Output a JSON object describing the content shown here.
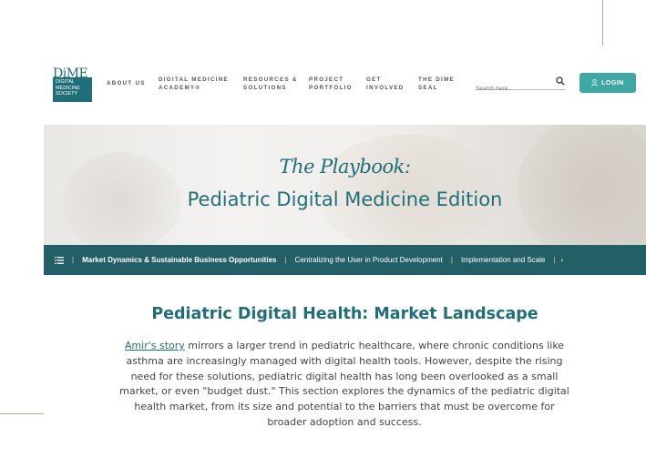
{
  "header": {
    "logo": {
      "wordmark": "DiME",
      "lines": [
        "DIGITAL",
        "MEDICINE",
        "SOCIETY"
      ]
    },
    "nav": [
      {
        "label_1": "ABOUT US",
        "label_2": ""
      },
      {
        "label_1": "DIGITAL MEDICINE",
        "label_2": "ACADEMY®"
      },
      {
        "label_1": "RESOURCES &",
        "label_2": "SOLUTIONS"
      },
      {
        "label_1": "PROJECT",
        "label_2": "PORTFOLIO"
      },
      {
        "label_1": "GET",
        "label_2": "INVOLVED"
      },
      {
        "label_1": "THE DIME",
        "label_2": "SEAL"
      }
    ],
    "search": {
      "placeholder": "Search here.."
    },
    "login_label": "LOGIN"
  },
  "hero": {
    "title_italic": "The Playbook:",
    "title_main": "Pediatric Digital Medicine Edition"
  },
  "subnav": {
    "items": [
      "Market Dynamics & Sustainable Business Opportunities",
      "Centralizing the User in Product Development",
      "Implementation and Scale"
    ],
    "active_index": 0
  },
  "content": {
    "title": "Pediatric Digital Health: Market Landscape",
    "link_text": "Amir's story",
    "body": " mirrors a larger trend in pediatric healthcare, where chronic conditions like asthma are increasingly managed with digital health tools. However, despite the rising need for these solutions, pediatric digital health has long been overlooked as a small market, or even \"budget dust.\" This section explores the dynamics of the pediatric digital health market, from its size and potential to the barriers that must be overcome for broader adoption and success."
  },
  "colors": {
    "brand_teal": "#1f6f78",
    "login_teal": "#3fa8a4",
    "subnav_bg": "#235f66",
    "frame_border": "#c9a28c"
  }
}
